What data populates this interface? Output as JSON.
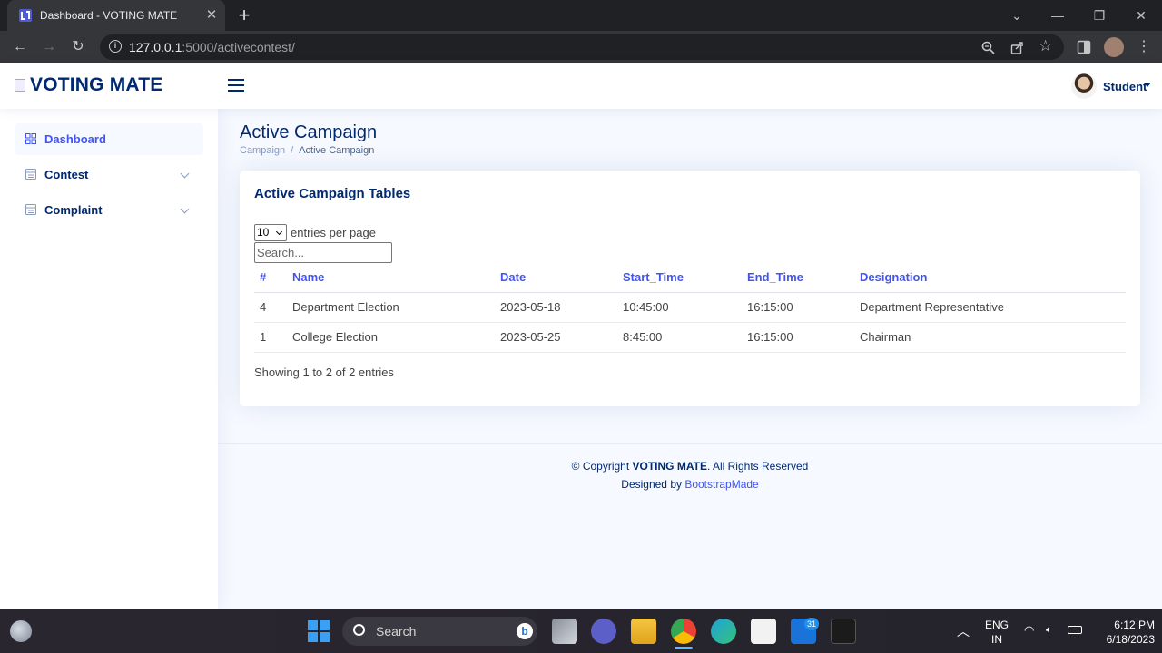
{
  "browser": {
    "tab_title": "Dashboard - VOTING MATE",
    "url_host": "127.0.0.1",
    "url_rest": ":5000/activecontest/"
  },
  "header": {
    "brand": "VOTING MATE",
    "user_name": "Student"
  },
  "sidebar": {
    "items": [
      {
        "label": "Dashboard"
      },
      {
        "label": "Contest"
      },
      {
        "label": "Complaint"
      }
    ]
  },
  "page": {
    "title": "Active Campaign",
    "breadcrumb": [
      "Campaign",
      "/",
      "Active Campaign"
    ]
  },
  "card": {
    "title": "Active Campaign Tables",
    "per_page_value": "10",
    "per_page_label": "entries per page",
    "search_placeholder": "Search...",
    "columns": [
      "#",
      "Name",
      "Date",
      "Start_Time",
      "End_Time",
      "Designation"
    ],
    "rows": [
      [
        "4",
        "Department Election",
        "2023-05-18",
        "10:45:00",
        "16:15:00",
        "Department Representative"
      ],
      [
        "1",
        "College Election",
        "2023-05-25",
        "8:45:00",
        "16:15:00",
        "Chairman"
      ]
    ],
    "showing": "Showing 1 to 2 of 2 entries"
  },
  "footer": {
    "copyright_prefix": "© Copyright ",
    "copyright_brand": "VOTING MATE",
    "copyright_suffix": ". All Rights Reserved",
    "designed_prefix": "Designed by ",
    "designed_link": "BootstrapMade"
  },
  "taskbar": {
    "search_label": "Search",
    "badge_count": "31",
    "lang_top": "ENG",
    "lang_bottom": "IN",
    "time": "6:12 PM",
    "date": "6/18/2023"
  },
  "colors": {
    "brand": "#012970",
    "accent": "#4154f1"
  }
}
